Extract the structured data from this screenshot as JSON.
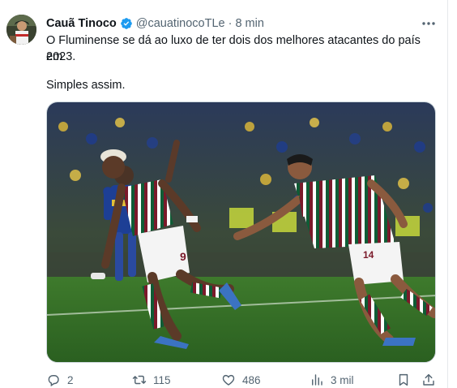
{
  "author": {
    "display_name": "Cauã Tinoco",
    "handle": "@cauatinocoTLe",
    "separator": "·",
    "time": "8 min",
    "verified_icon": "verified-badge-icon"
  },
  "tweet": {
    "line1": "O Fluminense se dá ao luxo de ter dois dos melhores atacantes do país em",
    "line2": "2023.",
    "line3": "Simples assim."
  },
  "media": {
    "kit_number_left": "9",
    "kit_number_right": "14"
  },
  "actions": {
    "reply_count": "2",
    "retweet_count": "115",
    "like_count": "486",
    "views_count": "3 mil"
  },
  "colors": {
    "text_primary": "#0f1419",
    "text_secondary": "#536471",
    "verified_blue": "#1d9bf0",
    "pitch_green": "#2d6b22",
    "fluminense_maroon": "#7a1a2a",
    "fluminense_green": "#0f5c35"
  }
}
